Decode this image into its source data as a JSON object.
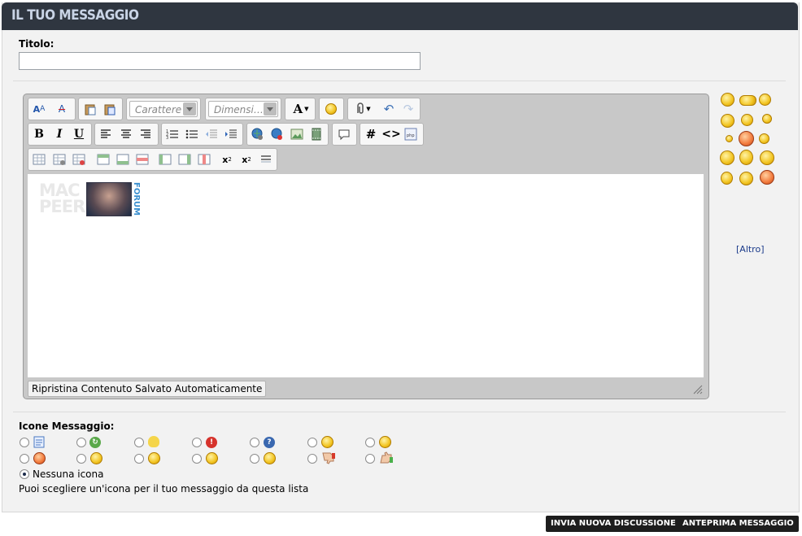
{
  "header": {
    "title": "IL TUO MESSAGGIO"
  },
  "title_field": {
    "label": "Titolo:",
    "value": ""
  },
  "toolbar": {
    "font_placeholder": "Carattere",
    "size_placeholder": "Dimensi…",
    "bold": "B",
    "italic": "I",
    "underline": "U",
    "hash": "#",
    "code": "<>",
    "subscript": "x",
    "superscript": "x"
  },
  "editor": {
    "logo_text": "MAC PEER FORUM",
    "restore_label": "Ripristina Contenuto Salvato Automaticamente"
  },
  "smilies": {
    "more_label": "[Altro]"
  },
  "message_icons": {
    "label": "Icone Messaggio:",
    "none_label": "Nessuna icona",
    "help_text": "Puoi scegliere un'icona per il tuo messaggio da questa lista",
    "icons": [
      "document",
      "arrow",
      "lightbulb",
      "exclamation",
      "question",
      "cool",
      "smile",
      "angry",
      "mad",
      "surprised",
      "happy",
      "grin",
      "thumbs-down",
      "thumbs-up"
    ]
  },
  "buttons": {
    "submit": "INVIA NUOVA DISCUSSIONE",
    "preview": "ANTEPRIMA MESSAGGIO"
  }
}
